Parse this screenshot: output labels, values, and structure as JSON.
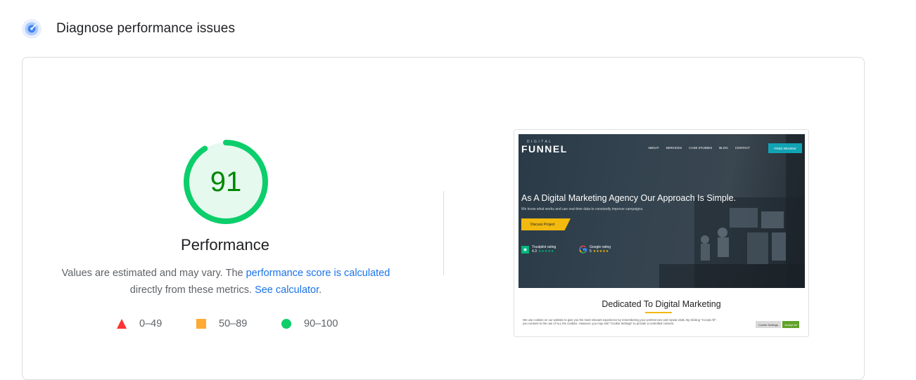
{
  "section": {
    "title": "Diagnose performance issues",
    "icon": "performance-gauge-icon",
    "icon_color": "#1a73e8"
  },
  "score": {
    "value": "91",
    "label": "Performance",
    "fraction": 0.91,
    "color": "#0cce6b",
    "text_color": "#008800",
    "fill_color": "#e6f9ef"
  },
  "description": {
    "part1": "Values are estimated and may vary. The ",
    "link1": "performance score is calculated",
    "part2": "directly from these metrics. ",
    "link2": "See calculator",
    "part3": "."
  },
  "legend": {
    "fail": "0–49",
    "average": "50–89",
    "pass": "90–100",
    "colors": {
      "fail": "#ff3333",
      "average": "#ffaa33",
      "pass": "#0cce6b"
    }
  },
  "screenshot": {
    "logo_small": "DIGITAL",
    "logo": "FUNNEL",
    "nav": [
      "ABOUT",
      "SERVICES",
      "CASE STUDIES",
      "BLOG",
      "CONTACT"
    ],
    "cta": "FREE REVIEW",
    "headline": "As A Digital Marketing Agency Our Approach Is Simple.",
    "subheadline": "We know what works and use real-time data to constantly improve campaigns.",
    "button": "Discuss Project",
    "trustpilot_title": "Trustpilot rating",
    "trustpilot_score": "4.3",
    "google_title": "Google rating",
    "google_score": "5",
    "heading": "Dedicated To Digital Marketing",
    "cookie_text": "We use cookies on our website to give you the most relevant experience by remembering your preferences and repeat visits. By clicking \"Accept All\", you consent to the use of ALL the cookies. However, you may visit \"Cookie Settings\" to provide a controlled consent.",
    "cookie_settings": "Cookie Settings",
    "cookie_accept": "Accept All"
  }
}
